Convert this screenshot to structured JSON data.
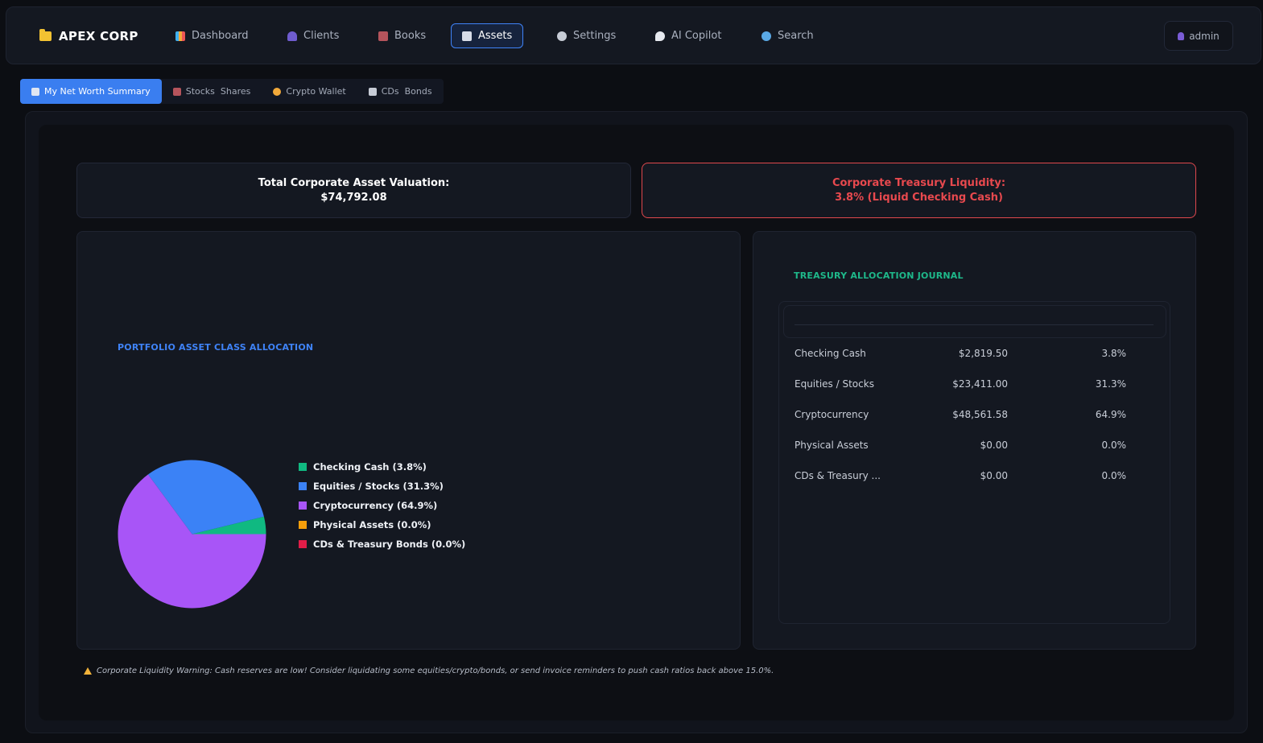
{
  "brand": {
    "name": "APEX CORP"
  },
  "nav": {
    "items": [
      {
        "label": "Dashboard",
        "icon": "chart-icon",
        "active": false
      },
      {
        "label": "Clients",
        "icon": "people-icon",
        "active": false
      },
      {
        "label": "Books",
        "icon": "briefcase-icon",
        "active": false
      },
      {
        "label": "Assets",
        "icon": "trend-chart-icon",
        "active": true
      },
      {
        "label": "Settings",
        "icon": "gear-icon",
        "active": false
      },
      {
        "label": "AI Copilot",
        "icon": "speech-bubble-icon",
        "active": false
      },
      {
        "label": "Search",
        "icon": "magnifier-icon",
        "active": false
      }
    ],
    "user": "admin"
  },
  "subtabs": [
    {
      "label": "My Net Worth Summary",
      "icon": "trend-chart-icon",
      "active": true
    },
    {
      "label": "Stocks  Shares",
      "icon": "briefcase-icon",
      "active": false
    },
    {
      "label": "Crypto Wallet",
      "icon": "coin-icon",
      "active": false
    },
    {
      "label": "CDs  Bonds",
      "icon": "bank-icon",
      "active": false
    }
  ],
  "stats": {
    "total_label": "Total Corporate Asset Valuation:",
    "total_value": "$74,792.08",
    "liquidity_label": "Corporate Treasury Liquidity:",
    "liquidity_value": "3.8% (Liquid Checking Cash)"
  },
  "allocation": {
    "title": "PORTFOLIO ASSET CLASS ALLOCATION"
  },
  "chart_data": {
    "type": "pie",
    "categories": [
      "Checking Cash",
      "Equities / Stocks",
      "Cryptocurrency",
      "Physical Assets",
      "CDs & Treasury Bonds"
    ],
    "values": [
      3.8,
      31.3,
      64.9,
      0.0,
      0.0
    ],
    "legend": [
      "Checking Cash (3.8%)",
      "Equities / Stocks (31.3%)",
      "Cryptocurrency (64.9%)",
      "Physical Assets (0.0%)",
      "CDs & Treasury Bonds (0.0%)"
    ],
    "colors": [
      "#10b981",
      "#3b82f6",
      "#a855f7",
      "#f59e0b",
      "#e11d48"
    ],
    "legend_position": "right"
  },
  "journal": {
    "title": "TREASURY ALLOCATION JOURNAL",
    "rows": [
      {
        "label": "Checking Cash",
        "amount": "$2,819.50",
        "pct": "3.8%"
      },
      {
        "label": "Equities / Stocks",
        "amount": "$23,411.00",
        "pct": "31.3%"
      },
      {
        "label": "Cryptocurrency",
        "amount": "$48,561.58",
        "pct": "64.9%"
      },
      {
        "label": "Physical Assets",
        "amount": "$0.00",
        "pct": "0.0%"
      },
      {
        "label": "CDs & Treasury ...",
        "amount": "$0.00",
        "pct": "0.0%"
      }
    ]
  },
  "warning": {
    "text": "Corporate Liquidity Warning: Cash reserves are low! Consider liquidating some equities/crypto/bonds, or send invoice reminders to push cash ratios back above 15.0%."
  }
}
